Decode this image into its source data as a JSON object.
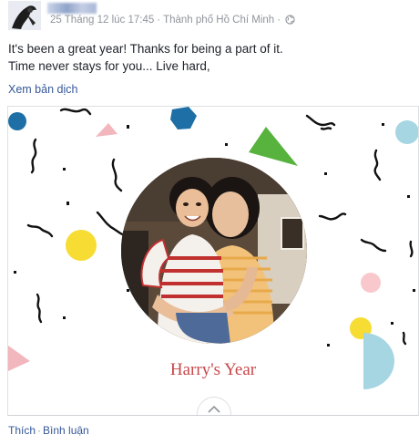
{
  "post": {
    "timestamp": "25 Tháng 12 lúc 17:45",
    "location": "Thành phố Hồ Chí Minh",
    "text_line1": "It's been a great year! Thanks for being a part of it.",
    "text_line2": "Time never stays for you... Live hard,",
    "translate_label": "Xem bản dịch"
  },
  "card": {
    "title": "Harry's Year"
  },
  "actions": {
    "like_label": "Thích",
    "comment_label": "Bình luận",
    "separator": "·"
  },
  "icons": {
    "privacy": "globe-icon",
    "expand": "chevron-up-icon"
  },
  "colors": {
    "link": "#365899",
    "meta": "#90949c",
    "title": "#c9474a",
    "confetti_blue": "#1d6fa5",
    "confetti_yellow": "#f7dc34",
    "confetti_green": "#57b33e",
    "confetti_pink": "#f2b6bd",
    "confetti_lightblue": "#a6d6e2"
  }
}
